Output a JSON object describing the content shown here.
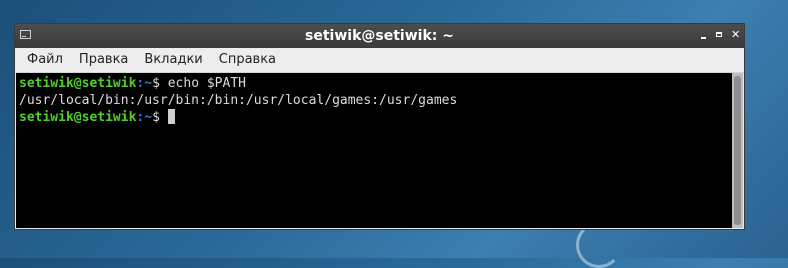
{
  "window": {
    "title": "setiwik@setiwik: ~"
  },
  "menu": {
    "items": [
      "Файл",
      "Правка",
      "Вкладки",
      "Справка"
    ]
  },
  "terminal": {
    "prompt_user": "setiwik@setiwik",
    "prompt_sep": ":",
    "prompt_path": "~",
    "prompt_symbol": "$",
    "command": "echo $PATH",
    "output": "/usr/local/bin:/usr/bin:/bin:/usr/local/games:/usr/games"
  },
  "icons": {
    "app": "terminal-icon",
    "minimize": "minimize-icon",
    "maximize": "maximize-icon",
    "close": "close-icon"
  },
  "colors": {
    "prompt_user": "#4fcf2a",
    "prompt_path": "#3d6fd6",
    "terminal_bg": "#000000",
    "titlebar_bg": "#3a3a3a"
  }
}
